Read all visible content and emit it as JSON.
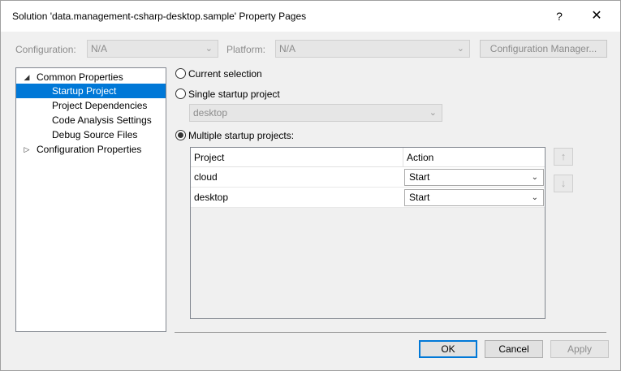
{
  "window": {
    "title": "Solution 'data.management-csharp-desktop.sample' Property Pages",
    "help_label": "?",
    "close_label": "✕"
  },
  "toolbar": {
    "configuration_label": "Configuration:",
    "configuration_value": "N/A",
    "platform_label": "Platform:",
    "platform_value": "N/A",
    "config_manager_label": "Configuration Manager..."
  },
  "tree": {
    "items": [
      {
        "label": "Common Properties",
        "expander": "◢"
      },
      {
        "label": "Startup Project"
      },
      {
        "label": "Project Dependencies"
      },
      {
        "label": "Code Analysis Settings"
      },
      {
        "label": "Debug Source Files"
      },
      {
        "label": "Configuration Properties",
        "expander": "▷"
      }
    ]
  },
  "options": {
    "current_selection_label": "Current selection",
    "single_startup_label": "Single startup project",
    "single_startup_value": "desktop",
    "multiple_startup_label": "Multiple startup projects:"
  },
  "grid": {
    "columns": [
      "Project",
      "Action"
    ],
    "rows": [
      {
        "project": "cloud",
        "action": "Start"
      },
      {
        "project": "desktop",
        "action": "Start"
      }
    ]
  },
  "side_buttons": {
    "up_icon": "↑",
    "down_icon": "↓"
  },
  "footer": {
    "ok_label": "OK",
    "cancel_label": "Cancel",
    "apply_label": "Apply"
  },
  "colors": {
    "accent": "#0078d7",
    "window_bg": "#f0f0f0"
  }
}
